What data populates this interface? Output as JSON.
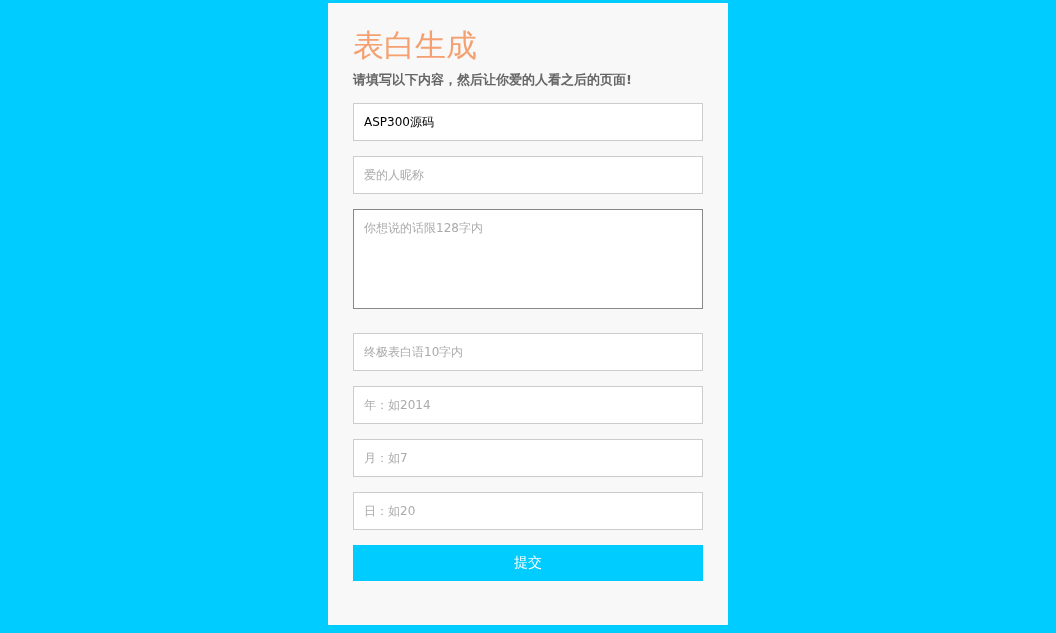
{
  "form": {
    "title": "表白生成",
    "subtitle": "请填写以下内容，然后让你爱的人看之后的页面!",
    "fields": [
      {
        "kind": "input",
        "value": "ASP300源码"
      },
      {
        "kind": "input",
        "placeholder": "爱的人昵称"
      },
      {
        "kind": "textarea",
        "placeholder": "你想说的话限128字内"
      },
      {
        "kind": "input",
        "placeholder": "终极表白语10字内"
      },
      {
        "kind": "input",
        "placeholder": "年：如2014"
      },
      {
        "kind": "input",
        "placeholder": "月：如7"
      },
      {
        "kind": "input",
        "placeholder": "日：如20"
      }
    ],
    "submit": "提交"
  }
}
